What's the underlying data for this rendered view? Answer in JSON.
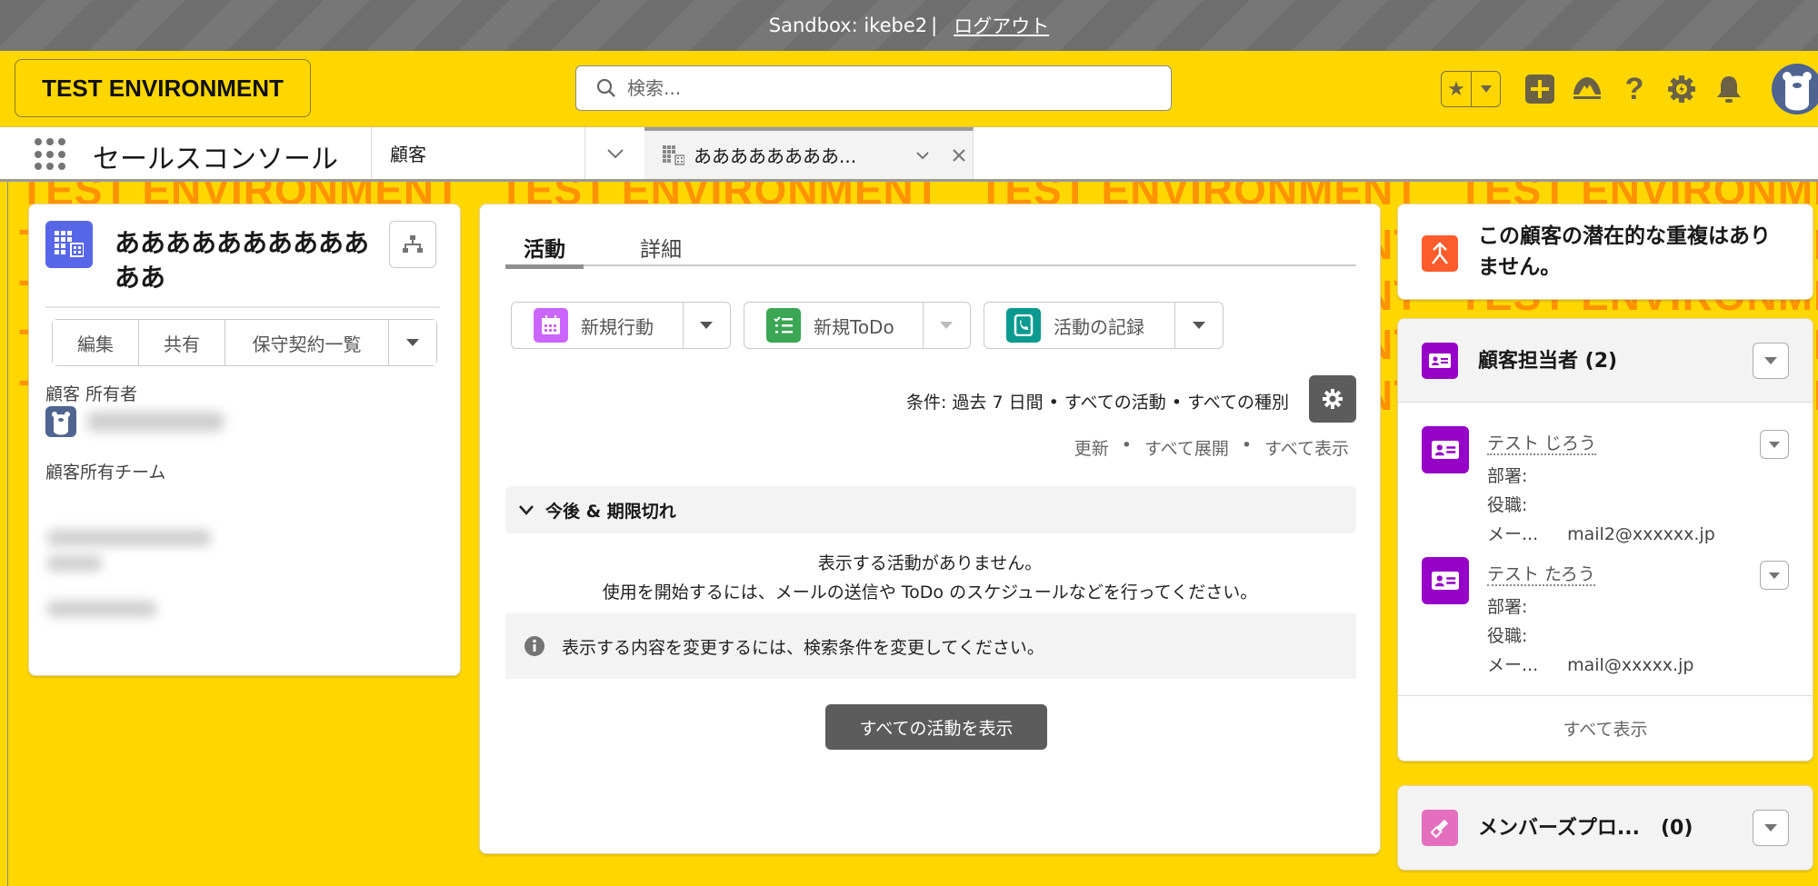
{
  "sandbox_bar": {
    "label": "Sandbox: ikebe2",
    "separator": "|",
    "logout": "ログアウト"
  },
  "header": {
    "env_badge": "TEST ENVIRONMENT",
    "search_placeholder": "検索...",
    "icons": [
      "star-icon",
      "chevron-down-icon",
      "add-icon",
      "trailhead-icon",
      "help-icon",
      "setup-gear-icon",
      "notification-bell-icon",
      "user-avatar"
    ]
  },
  "nav": {
    "app_name": "セールスコンソール",
    "object_tab": "顧客",
    "record_tab": "ああああああああ..."
  },
  "watermark": "TEST ENVIRONMENT",
  "record": {
    "title": "ああああああああああああ",
    "actions": [
      "編集",
      "共有",
      "保守契約一覧"
    ],
    "owner_label": "顧客 所有者",
    "team_label": "顧客所有チーム"
  },
  "activity": {
    "tabs": [
      {
        "label": "活動",
        "active": true
      },
      {
        "label": "詳細",
        "active": false
      }
    ],
    "publishers": [
      {
        "label": "新規行動",
        "icon": "calendar-icon",
        "color": "#cb65ff",
        "dropdown_enabled": true
      },
      {
        "label": "新規ToDo",
        "icon": "task-icon",
        "color": "#3ba755",
        "dropdown_enabled": false
      },
      {
        "label": "活動の記録",
        "icon": "log-a-call-icon",
        "color": "#0b9a8f",
        "dropdown_enabled": true
      }
    ],
    "filter_text": "条件: 過去 7 日間 • すべての活動 • すべての種別",
    "links": [
      "更新",
      "すべて展開",
      "すべて表示"
    ],
    "link_separator": "•",
    "section_title": "今後 & 期限切れ",
    "empty_line1": "表示する活動がありません。",
    "empty_line2": "使用を開始するには、メールの送信や ToDo のスケジュールなどを行ってください。",
    "info_text": "表示する内容を変更するには、検索条件を変更してください。",
    "show_all_button": "すべての活動を表示"
  },
  "duplicates": {
    "text": "この顧客の潜在的な重複はありません。",
    "color": "#fe5c2c"
  },
  "contacts": {
    "title": "顧客担当者 (2)",
    "color": "#9602c7",
    "items": [
      {
        "name": "テスト じろう",
        "dept_label": "部署:",
        "title_label": "役職:",
        "email_label": "メー...",
        "email": "mail2@xxxxxx.jp"
      },
      {
        "name": "テスト たろう",
        "dept_label": "部署:",
        "title_label": "役職:",
        "email_label": "メー...",
        "email": "mail@xxxxx.jp"
      }
    ],
    "view_all": "すべて表示"
  },
  "members": {
    "title": "メンバーズプロ...",
    "count": "(0)",
    "color": "#e46fbe"
  }
}
